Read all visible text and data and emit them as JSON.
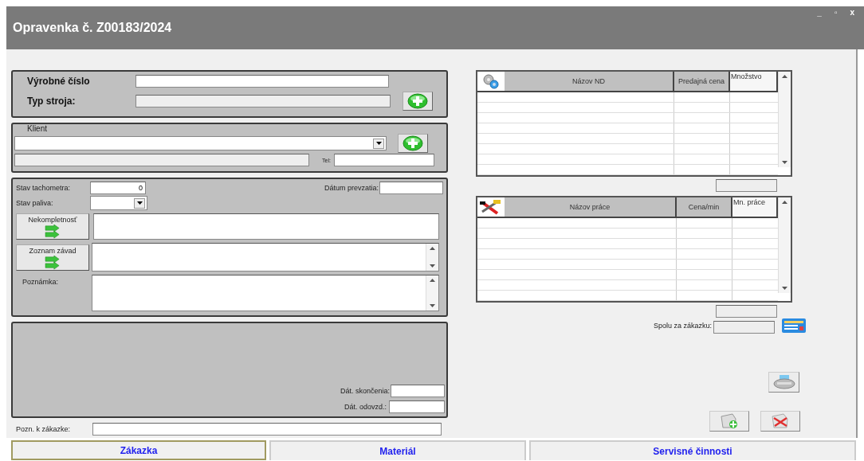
{
  "window": {
    "title": "Opravenka č. Z00183/2024",
    "controls": [
      "_",
      "▫",
      "x"
    ]
  },
  "machine": {
    "serial_label": "Výrobné číslo",
    "type_label": "Typ stroja:"
  },
  "client": {
    "label": "Klient",
    "phone_label": "Tel:"
  },
  "intake": {
    "odometer_label": "Stav tachometra:",
    "odometer_value": "0",
    "intake_date_label": "Dátum prevzatia:",
    "fuel_label": "Stav paliva:",
    "incompleteness_button": "Nekompletnosť",
    "faults_button": "Zoznam závad",
    "note_label": "Poznámka:"
  },
  "completion": {
    "finished_label": "Dát. skončenia:",
    "handover_label": "Dát. odovzd.:"
  },
  "order_note_label": "Pozn. k zákazke:",
  "parts_table": {
    "columns": [
      "Názov ND",
      "Predajná cena",
      "Množstvo"
    ]
  },
  "labor_table": {
    "columns": [
      "Názov práce",
      "Cena/min",
      "Mn. práce"
    ]
  },
  "order_total_label": "Spolu za zákazku:",
  "tabs": [
    {
      "label": "Zákazka",
      "selected": true
    },
    {
      "label": "Materiál",
      "selected": false
    },
    {
      "label": "Servisné činnosti",
      "selected": false
    }
  ]
}
